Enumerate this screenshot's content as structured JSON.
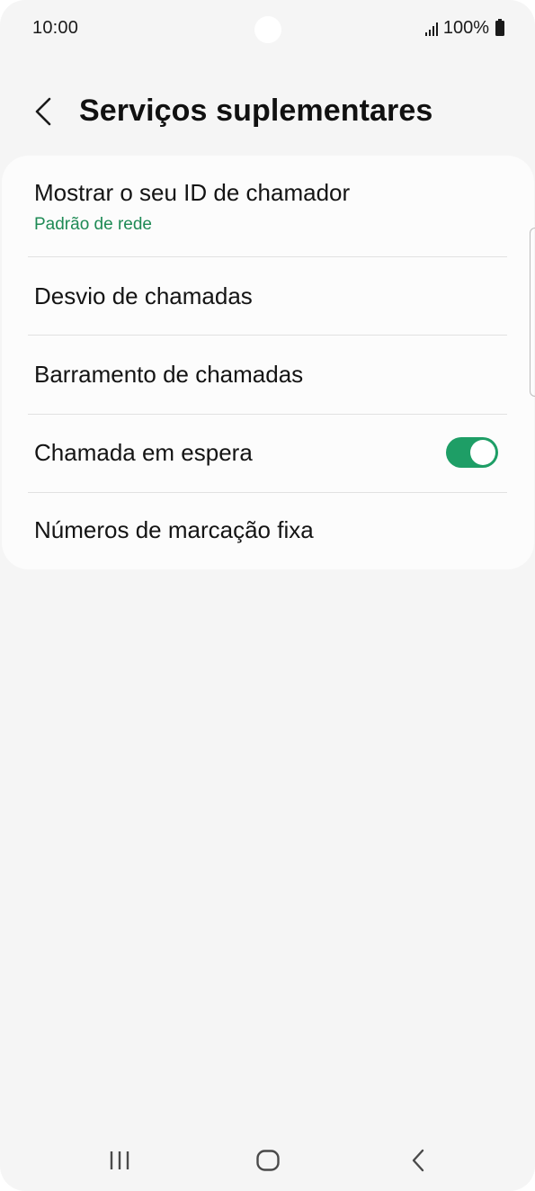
{
  "status_bar": {
    "time": "10:00",
    "battery": "100%",
    "icons": [
      "signal-icon",
      "battery-icon"
    ]
  },
  "header": {
    "back_icon": "chevron-left-icon",
    "title": "Serviços suplementares"
  },
  "settings": [
    {
      "title": "Mostrar o seu ID de chamador",
      "subtitle": "Padrão de rede"
    },
    {
      "title": "Desvio de chamadas"
    },
    {
      "title": "Barramento de chamadas"
    },
    {
      "title": "Chamada em espera",
      "toggle": true
    },
    {
      "title": "Números de marcação fixa"
    }
  ],
  "nav_bar": {
    "icons": [
      "recent-apps-icon",
      "home-icon",
      "back-icon"
    ]
  },
  "colors": {
    "accent": "#1e9e66",
    "background": "#f5f5f5",
    "card": "#fcfcfc",
    "subtitle": "#1e8a55"
  }
}
